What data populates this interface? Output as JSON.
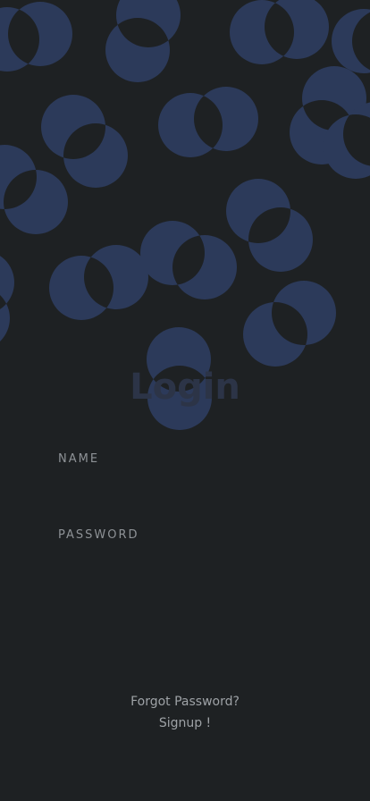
{
  "login": {
    "title": "Login",
    "name_label": "NAME",
    "name_value": "",
    "password_label": "PASSWORD",
    "password_value": "",
    "forgot_password": "Forgot Password?",
    "signup": "Signup !"
  },
  "colors": {
    "background": "#1e2123",
    "bubble": "#2c3a5a",
    "overlap": "#1e2123",
    "label": "#8e9296",
    "link": "#9ea2a6"
  }
}
